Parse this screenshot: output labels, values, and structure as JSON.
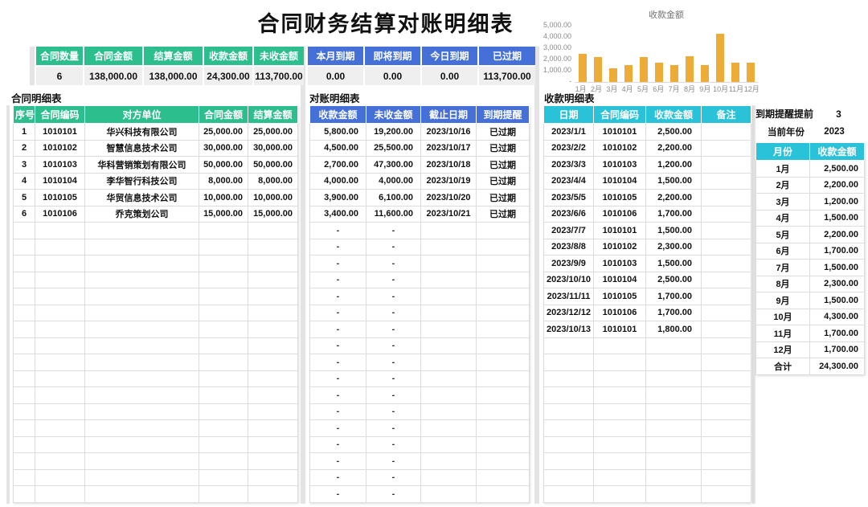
{
  "title": "合同财务结算对账明细表",
  "colors": {
    "green_header": "#2dbe8d",
    "blue_header": "#4470d8",
    "teal_header": "#29c2d8",
    "bar_gold": "#ecac37",
    "summary_value_bg": "#efefef"
  },
  "summary_left": {
    "headers": [
      "合同数量",
      "合同金额",
      "结算金额",
      "收款金额",
      "未收金额"
    ],
    "values": [
      "6",
      "138,000.00",
      "138,000.00",
      "24,300.00",
      "113,700.00"
    ]
  },
  "summary_right": {
    "headers": [
      "本月到期",
      "即将到期",
      "今日到期",
      "已过期"
    ],
    "values": [
      "0.00",
      "0.00",
      "0.00",
      "113,700.00"
    ]
  },
  "chart_data": {
    "type": "bar",
    "title": "收款金额",
    "categories": [
      "1月",
      "2月",
      "3月",
      "4月",
      "5月",
      "6月",
      "7月",
      "8月",
      "9月",
      "10月",
      "11月",
      "12月"
    ],
    "values": [
      2500,
      2200,
      1200,
      1500,
      2200,
      1700,
      1500,
      2300,
      1500,
      4300,
      1700,
      1700
    ],
    "xlabel": "",
    "ylabel": "",
    "ylim": [
      0,
      5000
    ],
    "yticks": [
      {
        "label": "5,000.00",
        "value": 5000
      },
      {
        "label": "4,000.00",
        "value": 4000
      },
      {
        "label": "3,000.00",
        "value": 3000
      },
      {
        "label": "2,000.00",
        "value": 2000
      },
      {
        "label": "1,000.00",
        "value": 1000
      },
      {
        "label": "-",
        "value": 0
      }
    ],
    "grid": false,
    "legend": "none",
    "bar_color": "#ecac37"
  },
  "sections": {
    "contract": {
      "label": "合同明细表",
      "headers": [
        "序号",
        "合同编码",
        "对方单位",
        "合同金额",
        "结算金额"
      ],
      "rows": [
        [
          "1",
          "1010101",
          "华兴科技有限公司",
          "25,000.00",
          "25,000.00"
        ],
        [
          "2",
          "1010102",
          "智慧信息技术公司",
          "30,000.00",
          "30,000.00"
        ],
        [
          "3",
          "1010103",
          "华科营销策划有限公司",
          "50,000.00",
          "50,000.00"
        ],
        [
          "4",
          "1010104",
          "李华智行科技公司",
          "8,000.00",
          "8,000.00"
        ],
        [
          "5",
          "1010105",
          "华贸信息技术公司",
          "10,000.00",
          "10,000.00"
        ],
        [
          "6",
          "1010106",
          "乔克策划公司",
          "15,000.00",
          "15,000.00"
        ]
      ],
      "empty_rows": 17,
      "empty_template": [
        "",
        "",
        "",
        "",
        ""
      ]
    },
    "reconcile": {
      "label": "对账明细表",
      "headers": [
        "收款金额",
        "未收金额",
        "截止日期",
        "到期提醒"
      ],
      "rows": [
        [
          "5,800.00",
          "19,200.00",
          "2023/10/16",
          "已过期"
        ],
        [
          "4,500.00",
          "25,500.00",
          "2023/10/17",
          "已过期"
        ],
        [
          "2,700.00",
          "47,300.00",
          "2023/10/18",
          "已过期"
        ],
        [
          "4,000.00",
          "4,000.00",
          "2023/10/19",
          "已过期"
        ],
        [
          "3,900.00",
          "6,100.00",
          "2023/10/20",
          "已过期"
        ],
        [
          "3,400.00",
          "11,600.00",
          "2023/10/21",
          "已过期"
        ]
      ],
      "empty_rows": 17,
      "empty_template": [
        "-",
        "-",
        "",
        ""
      ]
    },
    "receipts": {
      "label": "收款明细表",
      "headers": [
        "日期",
        "合同编码",
        "收款金额",
        "备注"
      ],
      "rows": [
        [
          "2023/1/1",
          "1010101",
          "2,500.00",
          ""
        ],
        [
          "2023/2/2",
          "1010102",
          "2,200.00",
          ""
        ],
        [
          "2023/3/3",
          "1010103",
          "1,200.00",
          ""
        ],
        [
          "2023/4/4",
          "1010104",
          "1,500.00",
          ""
        ],
        [
          "2023/5/5",
          "1010105",
          "2,200.00",
          ""
        ],
        [
          "2023/6/6",
          "1010106",
          "1,700.00",
          ""
        ],
        [
          "2023/7/7",
          "1010101",
          "1,500.00",
          ""
        ],
        [
          "2023/8/8",
          "1010102",
          "2,300.00",
          ""
        ],
        [
          "2023/9/9",
          "1010103",
          "1,500.00",
          ""
        ],
        [
          "2023/10/10",
          "1010104",
          "2,500.00",
          ""
        ],
        [
          "2023/11/11",
          "1010105",
          "1,700.00",
          ""
        ],
        [
          "2023/12/12",
          "1010106",
          "1,700.00",
          ""
        ],
        [
          "2023/10/13",
          "1010101",
          "1,800.00",
          ""
        ]
      ],
      "empty_rows": 10,
      "empty_template": [
        "",
        "",
        "",
        ""
      ]
    },
    "monthly": {
      "headers": [
        "月份",
        "收款金额"
      ],
      "rows": [
        [
          "1月",
          "2,500.00"
        ],
        [
          "2月",
          "2,200.00"
        ],
        [
          "3月",
          "1,200.00"
        ],
        [
          "4月",
          "1,500.00"
        ],
        [
          "5月",
          "2,200.00"
        ],
        [
          "6月",
          "1,700.00"
        ],
        [
          "7月",
          "1,500.00"
        ],
        [
          "8月",
          "2,300.00"
        ],
        [
          "9月",
          "1,500.00"
        ],
        [
          "10月",
          "4,300.00"
        ],
        [
          "11月",
          "1,700.00"
        ],
        [
          "12月",
          "1,700.00"
        ],
        [
          "合计",
          "24,300.00"
        ]
      ],
      "empty_rows": 0,
      "empty_template": [
        "",
        ""
      ]
    }
  },
  "settings": {
    "remind_label": "到期提醒提前",
    "remind_value": "3",
    "year_label": "当前年份",
    "year_value": "2023"
  }
}
